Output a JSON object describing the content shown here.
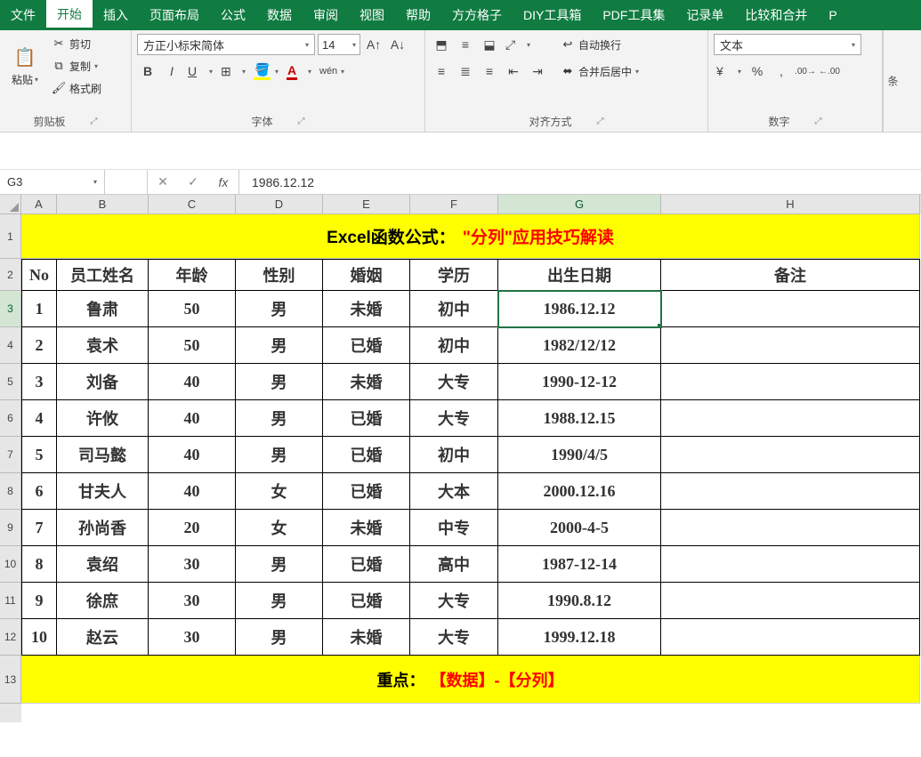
{
  "menu": {
    "items": [
      "文件",
      "开始",
      "插入",
      "页面布局",
      "公式",
      "数据",
      "审阅",
      "视图",
      "帮助",
      "方方格子",
      "DIY工具箱",
      "PDF工具集",
      "记录单",
      "比较和合并",
      "P"
    ],
    "active": 1
  },
  "ribbon": {
    "clipboard": {
      "label": "剪贴板",
      "paste": "粘贴",
      "cut": "剪切",
      "copy": "复制",
      "format_painter": "格式刷"
    },
    "font": {
      "label": "字体",
      "name": "方正小标宋简体",
      "size": "14"
    },
    "align": {
      "label": "对齐方式",
      "wrap": "自动换行",
      "merge": "合并后居中"
    },
    "number": {
      "label": "数字",
      "format": "文本"
    },
    "side": "条"
  },
  "formula_bar": {
    "name_box": "G3",
    "value": "1986.12.12"
  },
  "cols": [
    "A",
    "B",
    "C",
    "D",
    "E",
    "F",
    "G",
    "H"
  ],
  "row_numbers": [
    "1",
    "2",
    "3",
    "4",
    "5",
    "6",
    "7",
    "8",
    "9",
    "10",
    "11",
    "12",
    "13"
  ],
  "title": {
    "black": "Excel函数公式：",
    "red": "\"分列\"应用技巧解读"
  },
  "headers": [
    "No",
    "员工姓名",
    "年龄",
    "性别",
    "婚姻",
    "学历",
    "出生日期",
    "备注"
  ],
  "rows": [
    [
      "1",
      "鲁肃",
      "50",
      "男",
      "未婚",
      "初中",
      "1986.12.12",
      ""
    ],
    [
      "2",
      "袁术",
      "50",
      "男",
      "已婚",
      "初中",
      "1982/12/12",
      ""
    ],
    [
      "3",
      "刘备",
      "40",
      "男",
      "未婚",
      "大专",
      "1990-12-12",
      ""
    ],
    [
      "4",
      "许攸",
      "40",
      "男",
      "已婚",
      "大专",
      "1988.12.15",
      ""
    ],
    [
      "5",
      "司马懿",
      "40",
      "男",
      "已婚",
      "初中",
      "1990/4/5",
      ""
    ],
    [
      "6",
      "甘夫人",
      "40",
      "女",
      "已婚",
      "大本",
      "2000.12.16",
      ""
    ],
    [
      "7",
      "孙尚香",
      "20",
      "女",
      "未婚",
      "中专",
      "2000-4-5",
      ""
    ],
    [
      "8",
      "袁绍",
      "30",
      "男",
      "已婚",
      "高中",
      "1987-12-14",
      ""
    ],
    [
      "9",
      "徐庶",
      "30",
      "男",
      "已婚",
      "大专",
      "1990.8.12",
      ""
    ],
    [
      "10",
      "赵云",
      "30",
      "男",
      "未婚",
      "大专",
      "1999.12.18",
      ""
    ]
  ],
  "footer": {
    "black": "重点：",
    "red": "【数据】-【分列】"
  },
  "row_heights": {
    "title": 50,
    "header": 36,
    "data": 41,
    "footer": 54
  },
  "selected": {
    "col": "G",
    "row": 3
  }
}
